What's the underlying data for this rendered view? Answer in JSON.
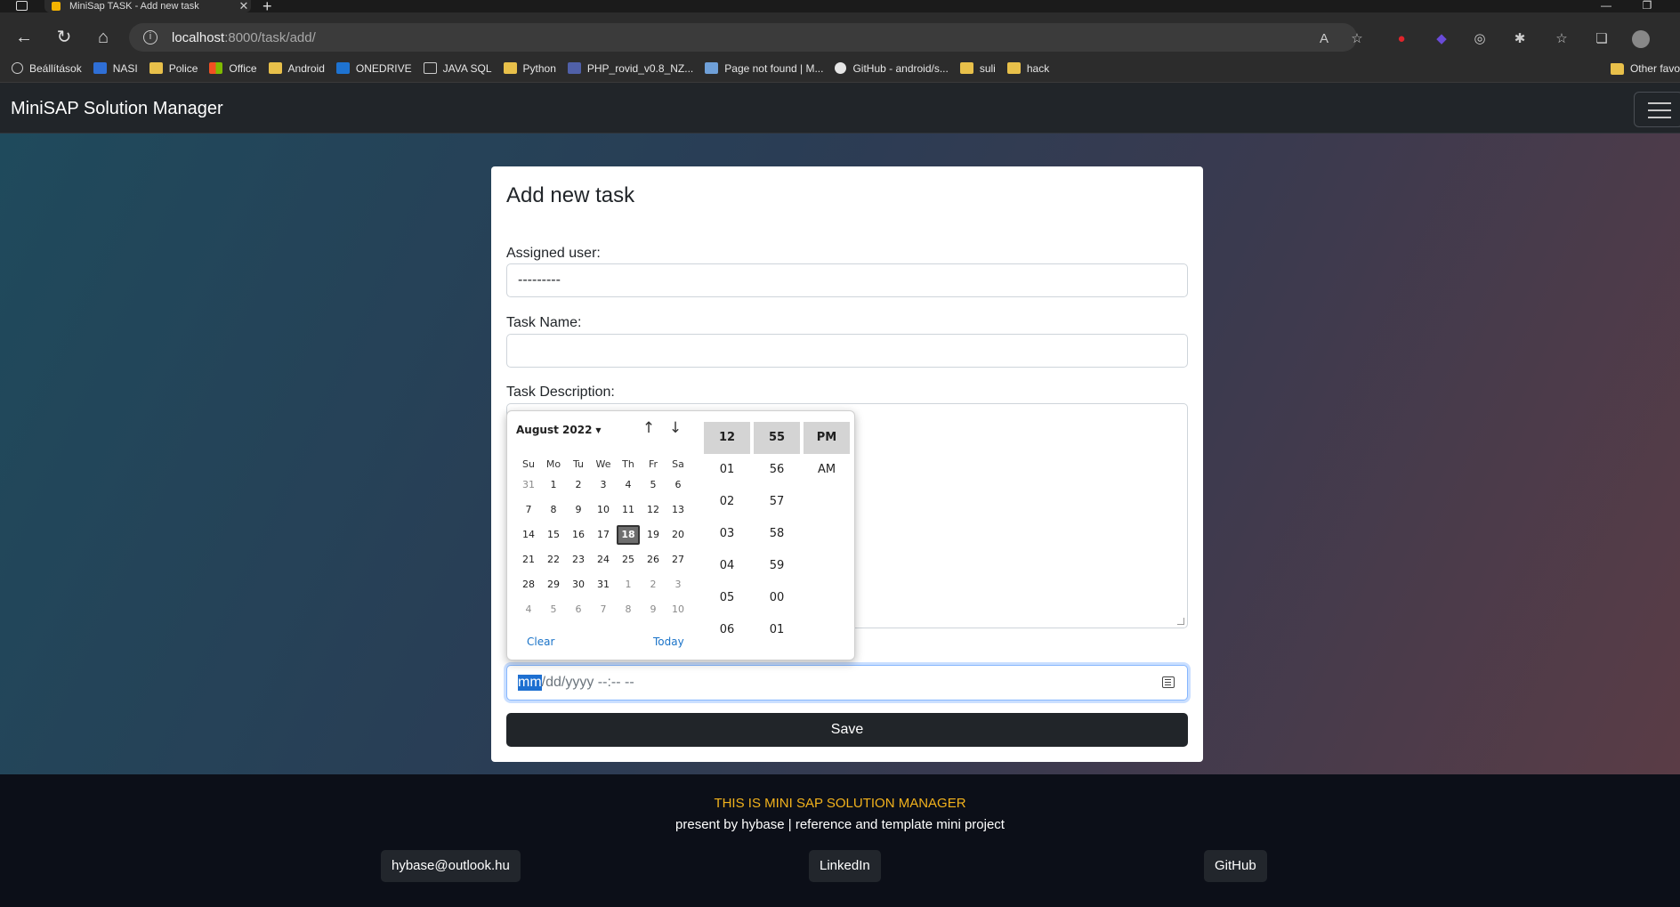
{
  "browser": {
    "tab_title": "MiniSap TASK - Add new task",
    "url_host": "localhost",
    "url_path": ":8000/task/add/",
    "bookmarks": [
      {
        "label": "Beállítások",
        "icon": "gear-icon"
      },
      {
        "label": "NASI",
        "icon": "nasi-icon"
      },
      {
        "label": "Police",
        "icon": "folder-icon"
      },
      {
        "label": "Office",
        "icon": "office-icon"
      },
      {
        "label": "Android",
        "icon": "folder-icon"
      },
      {
        "label": "ONEDRIVE",
        "icon": "onedrive-icon"
      },
      {
        "label": "JAVA SQL",
        "icon": "terminal-icon"
      },
      {
        "label": "Python",
        "icon": "folder-icon"
      },
      {
        "label": "PHP_rovid_v0.8_NZ...",
        "icon": "php-icon"
      },
      {
        "label": "Page not found | M...",
        "icon": "page-icon"
      },
      {
        "label": "GitHub - android/s...",
        "icon": "github-icon"
      },
      {
        "label": "suli",
        "icon": "folder-icon"
      },
      {
        "label": "hack",
        "icon": "folder-icon"
      }
    ],
    "other_favorites": "Other favo"
  },
  "navbar": {
    "brand": "MiniSAP Solution Manager"
  },
  "form": {
    "title": "Add new task",
    "assigned_user_label": "Assigned user:",
    "assigned_user_value": "---------",
    "task_name_label": "Task Name:",
    "task_name_value": "",
    "task_description_label": "Task Description:",
    "datetime_selected": "mm",
    "datetime_rest": "/dd/yyyy --:-- --",
    "save_label": "Save"
  },
  "picker": {
    "month_label": "August 2022",
    "weekdays": [
      "Su",
      "Mo",
      "Tu",
      "We",
      "Th",
      "Fr",
      "Sa"
    ],
    "weeks": [
      [
        "31",
        "1",
        "2",
        "3",
        "4",
        "5",
        "6"
      ],
      [
        "7",
        "8",
        "9",
        "10",
        "11",
        "12",
        "13"
      ],
      [
        "14",
        "15",
        "16",
        "17",
        "18",
        "19",
        "20"
      ],
      [
        "21",
        "22",
        "23",
        "24",
        "25",
        "26",
        "27"
      ],
      [
        "28",
        "29",
        "30",
        "31",
        "1",
        "2",
        "3"
      ],
      [
        "4",
        "5",
        "6",
        "7",
        "8",
        "9",
        "10"
      ]
    ],
    "selected_day": "18",
    "clear_label": "Clear",
    "today_label": "Today",
    "hours": [
      "12",
      "01",
      "02",
      "03",
      "04",
      "05",
      "06"
    ],
    "minutes": [
      "55",
      "56",
      "57",
      "58",
      "59",
      "00",
      "01"
    ],
    "ampm": [
      "PM",
      "AM"
    ]
  },
  "footer": {
    "headline": "THIS IS MINI SAP SOLUTION MANAGER",
    "subline": "present by hybase | reference and template mini project",
    "email": "hybase@outlook.hu",
    "linkedin": "LinkedIn",
    "github": "GitHub"
  },
  "colors": {
    "navbar_bg": "#212529",
    "footer_headline": "#f2b21c",
    "focus_blue": "#86b7fe",
    "selection_blue": "#1d6fd1"
  }
}
